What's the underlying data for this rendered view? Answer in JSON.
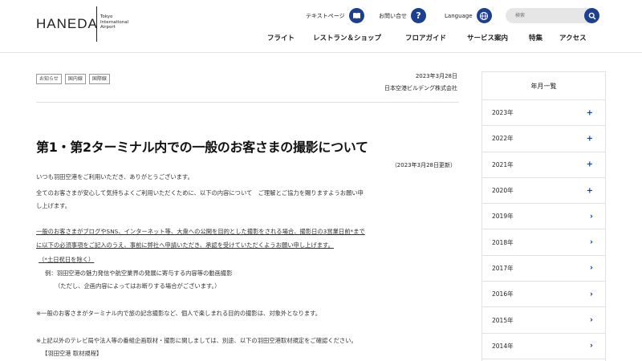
{
  "header": {
    "logo": "HANEDA",
    "logo_sub": [
      "Tokyo",
      "International",
      "Airport"
    ],
    "util": [
      {
        "label": "テキストページ",
        "icon": "book-icon"
      },
      {
        "label": "お問い合せ",
        "icon": "question-icon"
      },
      {
        "label": "Language",
        "icon": "globe-icon"
      }
    ],
    "search_placeholder": "検索",
    "nav": [
      "フライト",
      "レストラン＆ショップ",
      "フロアガイド",
      "サービス案内",
      "特集",
      "アクセス"
    ]
  },
  "article": {
    "tags": [
      "お知らせ",
      "国内線",
      "国際線"
    ],
    "date": "2023年3月28日",
    "org": "日本空港ビルデング株式会社",
    "title": "第1・第2ターミナル内での一般のお客さまの撮影について",
    "updated": "（2023年3月28日更新）",
    "paragraphs": [
      "いつも羽田空港をご利用いただき、ありがとうございます。",
      "全てのお客さまが安心して気持ちよくご利用いただくために、以下の内容について　ご理解とご協力を賜りますようお願い申",
      "し上げます。",
      "一般のお客さまがブログやSNS、インターネット等、大衆への公開を目的とした撮影をされる場合、撮影日の3営業日前*まで",
      "に以下の必須事項をご記入のうえ、事前に弊社へ申請いただき、承認を受けていただくようお願い申し上げます。",
      "（*土日祝日を除く）",
      "例：羽田空港の魅力発信や航空業界の発展に寄与する内容等の動画撮影",
      "（ただし、企画内容によってはお断りする場合がございます。）",
      "※一般のお客さまがターミナル内で旅の記念撮影など、個人で楽しまれる目的の撮影は、対象外となります。",
      "※上記以外のテレビ局や法人等の番組企画取材・撮影に関しましては、別途、以下の羽田空港取材規定をご確認ください。",
      "【羽田空港 取材規程】"
    ]
  },
  "sidebar": {
    "title": "年月一覧",
    "years": [
      {
        "label": "2023年",
        "mark": "+"
      },
      {
        "label": "2022年",
        "mark": "+"
      },
      {
        "label": "2021年",
        "mark": "+"
      },
      {
        "label": "2020年",
        "mark": "+"
      },
      {
        "label": "2019年",
        "mark": "›"
      },
      {
        "label": "2018年",
        "mark": "›"
      },
      {
        "label": "2017年",
        "mark": "›"
      },
      {
        "label": "2016年",
        "mark": "›"
      },
      {
        "label": "2015年",
        "mark": "›"
      },
      {
        "label": "2014年",
        "mark": "›"
      }
    ]
  },
  "colors": {
    "accent": "#1d3f8f",
    "rule": "#e2e2e2",
    "text": "#222222"
  }
}
